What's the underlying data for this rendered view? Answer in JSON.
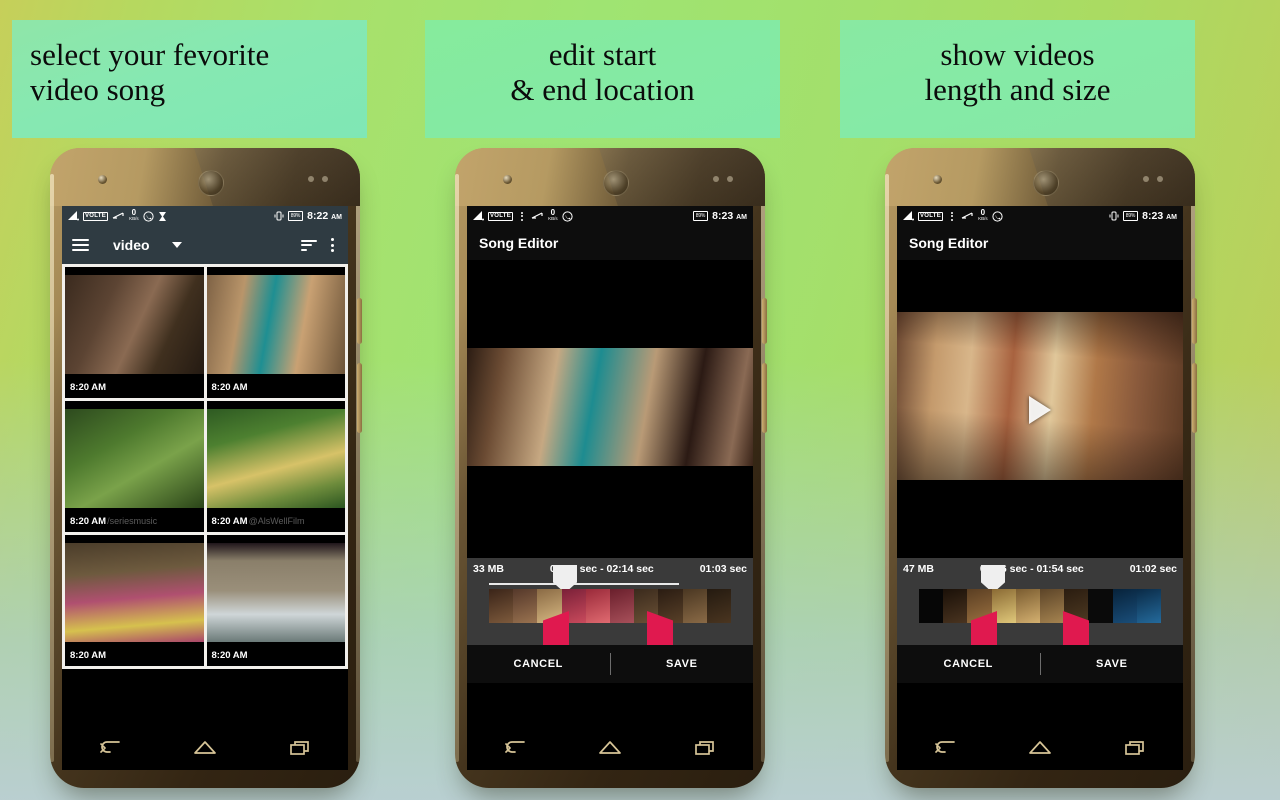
{
  "captions": [
    {
      "lines": [
        "select your fevorite",
        "video song"
      ],
      "align": "left"
    },
    {
      "lines": [
        "edit start",
        "& end location"
      ],
      "align": "center"
    },
    {
      "lines": [
        "show videos",
        "length and size"
      ],
      "align": "center"
    }
  ],
  "phones": [
    {
      "id": "phone-gallery",
      "status": {
        "volte": "VOLTE",
        "data_rate": "0",
        "data_unit": "KB/s",
        "battery": "89%",
        "time": "8:22",
        "meridiem": "AM",
        "icons": [
          "signal-icon",
          "volte-icon",
          "network-arrows-icon",
          "data-rate-icon",
          "whatsapp-icon",
          "hourglass-icon",
          "vibrate-icon",
          "battery-icon"
        ]
      },
      "toolbar": {
        "menu_icon": "hamburger-icon",
        "title": "video",
        "dropdown_icon": "chevron-down-icon",
        "sort_icon": "sort-icon",
        "overflow_icon": "overflow-menu-icon"
      },
      "grid": [
        {
          "timestamp": "8:20 AM",
          "watermark": "",
          "c1": "#3a2a1e",
          "c2": "#8a6a52",
          "c3": "#2b2018"
        },
        {
          "timestamp": "8:20 AM",
          "watermark": "",
          "c1": "#b9956a",
          "c2": "#1e8f92",
          "c3": "#c9a173"
        },
        {
          "timestamp": "8:20 AM",
          "watermark": "/seriesmusic",
          "c1": "#2d4a1e",
          "c2": "#7aa24a",
          "c3": "#1b3312"
        },
        {
          "timestamp": "8:20 AM",
          "watermark": "@AlsWellFilm",
          "c1": "#3b6b28",
          "c2": "#d7c268",
          "c3": "#2b5520"
        },
        {
          "timestamp": "8:20 AM",
          "watermark": "",
          "c1": "#6d5a3e",
          "c2": "#c24a6a",
          "c3": "#d6c14e"
        },
        {
          "timestamp": "8:20 AM",
          "watermark": "",
          "c1": "#9a8f7a",
          "c2": "#cfd6d8",
          "c3": "#6b7a78"
        }
      ],
      "navigation": [
        "back-icon",
        "home-icon",
        "recents-icon"
      ]
    },
    {
      "id": "phone-editor-1",
      "status": {
        "volte": "VOLTE",
        "data_rate": "0",
        "data_unit": "KB/s",
        "battery": "89%",
        "time": "8:23",
        "meridiem": "AM",
        "icons": [
          "signal-icon",
          "volte-icon",
          "overflow-menu-icon",
          "network-arrows-icon",
          "data-rate-icon",
          "whatsapp-icon",
          "battery-icon"
        ]
      },
      "app_title": "Song Editor",
      "trim": {
        "file_size": "33 MB",
        "range": "01:01 sec - 02:14 sec",
        "duration": "01:03 sec",
        "playhead_percent": 31,
        "left_handle_percent": 28,
        "right_handle_percent": 68
      },
      "actions": {
        "cancel": "CANCEL",
        "save": "SAVE"
      },
      "show_play_button": false,
      "navigation": [
        "back-icon",
        "home-icon",
        "recents-icon"
      ]
    },
    {
      "id": "phone-editor-2",
      "status": {
        "volte": "VOLTE",
        "data_rate": "0",
        "data_unit": "KB/s",
        "battery": "89%",
        "time": "8:23",
        "meridiem": "AM",
        "icons": [
          "signal-icon",
          "volte-icon",
          "overflow-menu-icon",
          "network-arrows-icon",
          "data-rate-icon",
          "whatsapp-icon",
          "vibrate-icon",
          "battery-icon"
        ]
      },
      "app_title": "Song Editor",
      "trim": {
        "file_size": "47 MB",
        "range": "00:56 sec - 01:54 sec",
        "duration": "01:02 sec",
        "playhead_percent": 30,
        "left_handle_percent": 27,
        "right_handle_percent": 63
      },
      "actions": {
        "cancel": "CANCEL",
        "save": "SAVE"
      },
      "show_play_button": true,
      "play_icon": "play-icon",
      "navigation": [
        "back-icon",
        "home-icon",
        "recents-icon"
      ]
    }
  ],
  "colors": {
    "accent_pink": "#e0194f",
    "toolbar_blue_grey": "#2f3b42",
    "panel_grey": "#3a3a3a",
    "nav_gold": "#e2cfa0",
    "caption_green": "#85e9a6"
  }
}
